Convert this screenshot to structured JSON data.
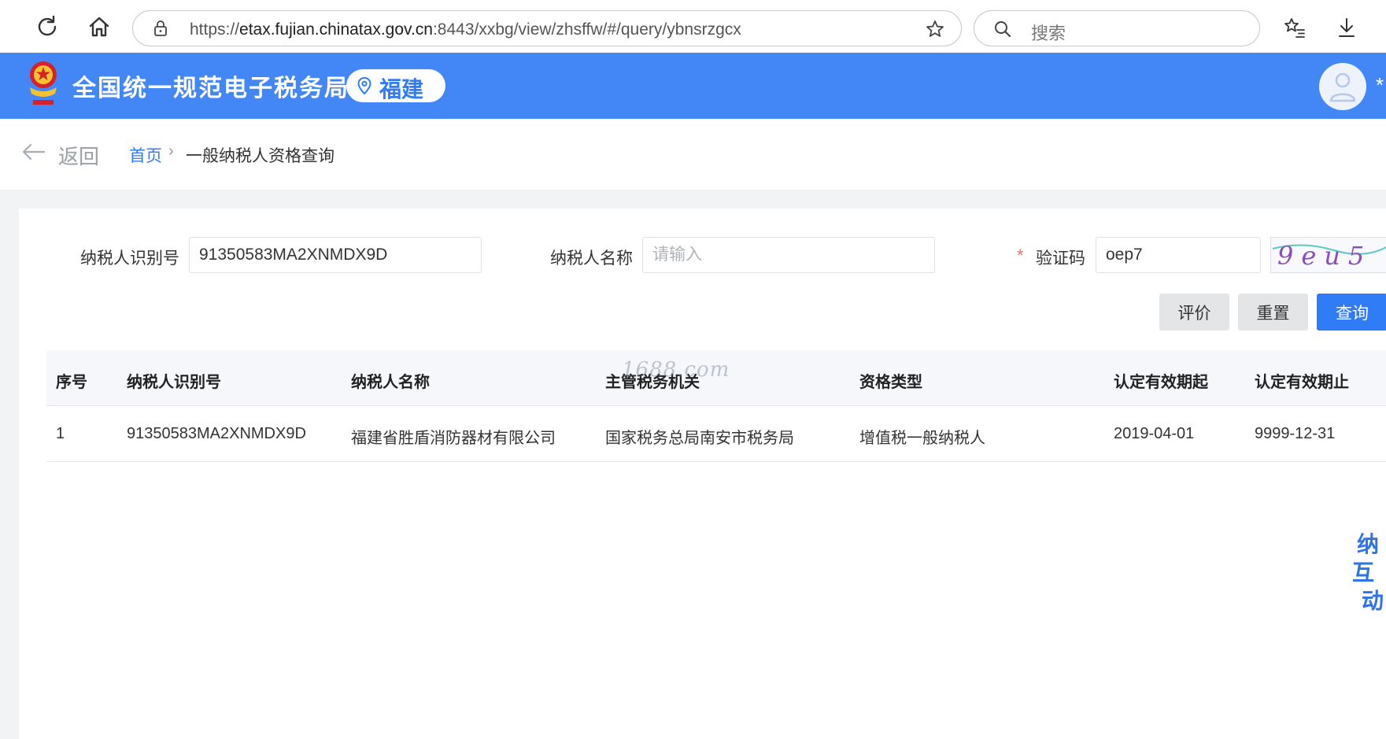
{
  "browser": {
    "url_scheme": "https://",
    "url_host": "etax.fujian.chinatax.gov.cn",
    "url_rest": ":8443/xxbg/view/zhsffw/#/query/ybnsrzgcx",
    "search_placeholder": "搜索"
  },
  "header": {
    "title": "全国统一规范电子税务局",
    "region": "福建",
    "extra_symbol": "*"
  },
  "breadcrumb": {
    "back_label": "返回",
    "home": "首页",
    "separator": "›",
    "current": "一般纳税人资格查询"
  },
  "form": {
    "taxpayer_id_label": "纳税人识别号",
    "taxpayer_id_value": "91350583MA2XNMDX9D",
    "taxpayer_name_label": "纳税人名称",
    "taxpayer_name_placeholder": "请输入",
    "required_mark": "*",
    "captcha_label": "验证码",
    "captcha_value": "oep7",
    "captcha_image_text": "9eu5"
  },
  "buttons": {
    "rate": "评价",
    "reset": "重置",
    "query": "查询"
  },
  "table": {
    "columns": [
      "序号",
      "纳税人识别号",
      "纳税人名称",
      "主管税务机关",
      "资格类型",
      "认定有效期起",
      "认定有效期止"
    ],
    "rows": [
      [
        "1",
        "91350583MA2XNMDX9D",
        "福建省胜盾消防器材有限公司",
        "国家税务总局南安市税务局",
        "增值税一般纳税人",
        "2019-04-01",
        "9999-12-31"
      ]
    ]
  },
  "watermark": "1688.com",
  "float_widget": [
    "纳",
    "互",
    "动"
  ],
  "colors": {
    "header_blue": "#4287f5",
    "primary": "#2f7cf6",
    "required": "#f56c6c"
  }
}
